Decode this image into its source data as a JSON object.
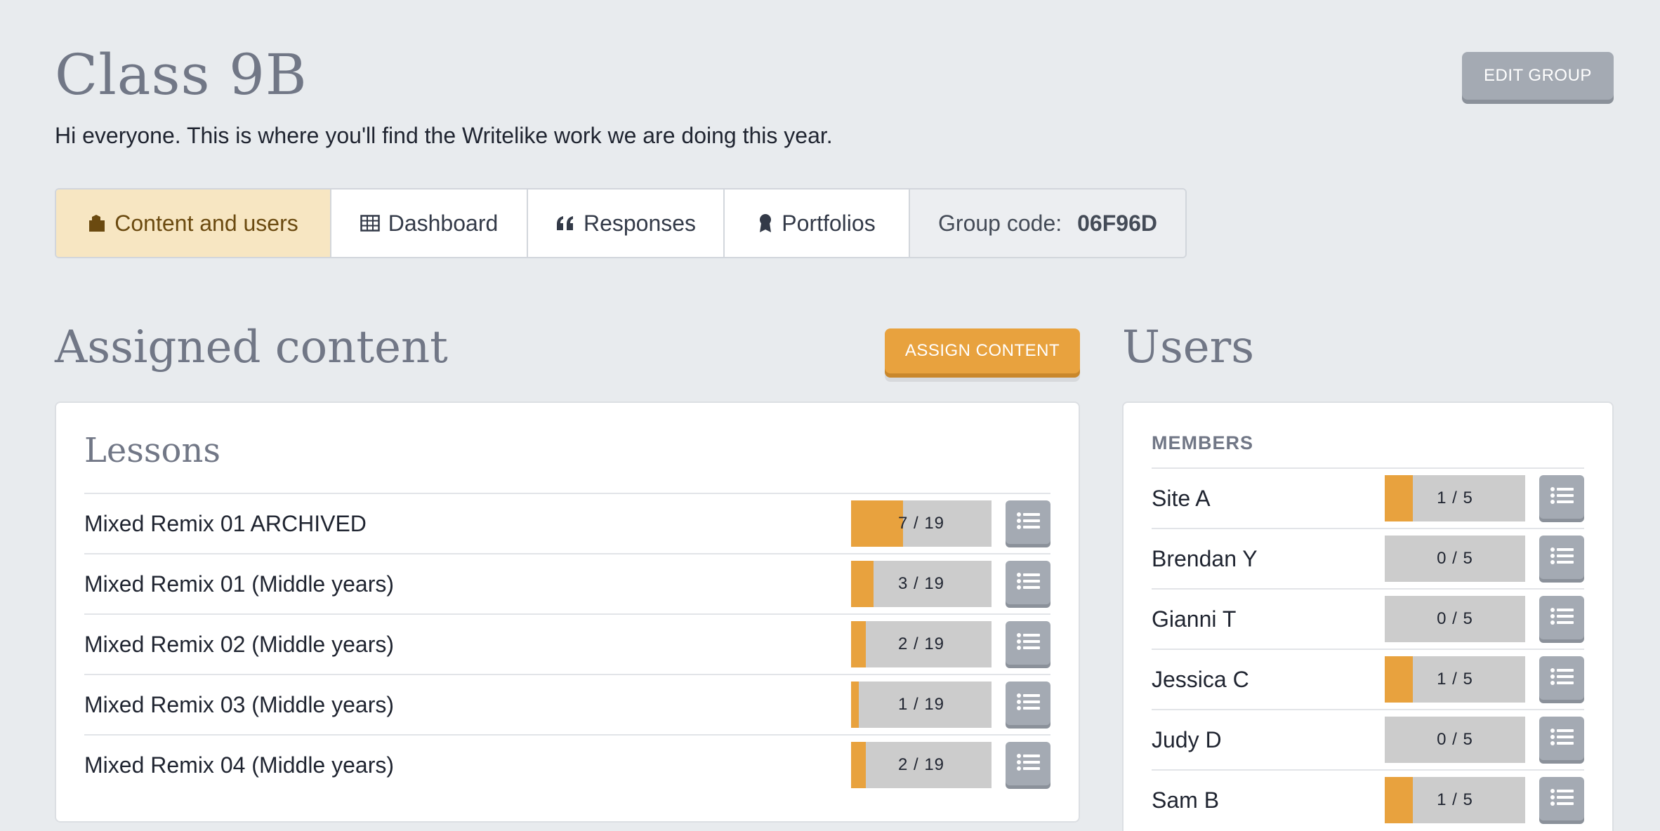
{
  "header": {
    "title": "Class 9B",
    "description": "Hi everyone. This is where you'll find the Writelike work we are doing this year.",
    "edit_button": "EDIT GROUP"
  },
  "tabs": [
    {
      "label": "Content and users",
      "icon": "folder-icon",
      "active": true
    },
    {
      "label": "Dashboard",
      "icon": "table-icon",
      "active": false
    },
    {
      "label": "Responses",
      "icon": "quote-icon",
      "active": false
    },
    {
      "label": "Portfolios",
      "icon": "award-icon",
      "active": false
    }
  ],
  "group_code": {
    "label": "Group code:",
    "value": "06F96D"
  },
  "assigned": {
    "title": "Assigned content",
    "assign_button": "ASSIGN CONTENT",
    "lessons_heading": "Lessons",
    "lessons": [
      {
        "name": "Mixed Remix 01 ARCHIVED",
        "done": 7,
        "total": 19,
        "progress": "7 / 19"
      },
      {
        "name": "Mixed Remix 01 (Middle years)",
        "done": 3,
        "total": 19,
        "progress": "3 / 19"
      },
      {
        "name": "Mixed Remix 02 (Middle years)",
        "done": 2,
        "total": 19,
        "progress": "2 / 19"
      },
      {
        "name": "Mixed Remix 03 (Middle years)",
        "done": 1,
        "total": 19,
        "progress": "1 / 19"
      },
      {
        "name": "Mixed Remix 04 (Middle years)",
        "done": 2,
        "total": 19,
        "progress": "2 / 19"
      }
    ]
  },
  "users": {
    "title": "Users",
    "members_heading": "MEMBERS",
    "members": [
      {
        "name": "Site A",
        "done": 1,
        "total": 5,
        "progress": "1 / 5"
      },
      {
        "name": "Brendan Y",
        "done": 0,
        "total": 5,
        "progress": "0 / 5"
      },
      {
        "name": "Gianni T",
        "done": 0,
        "total": 5,
        "progress": "0 / 5"
      },
      {
        "name": "Jessica C",
        "done": 1,
        "total": 5,
        "progress": "1 / 5"
      },
      {
        "name": "Judy D",
        "done": 0,
        "total": 5,
        "progress": "0 / 5"
      },
      {
        "name": "Sam B",
        "done": 1,
        "total": 5,
        "progress": "1 / 5"
      }
    ]
  },
  "colors": {
    "accent": "#e8a23e",
    "active_tab": "#f7e6c2",
    "button_gray": "#a4aab3",
    "progress_track": "#cccccc",
    "heading_gray": "#717786"
  }
}
